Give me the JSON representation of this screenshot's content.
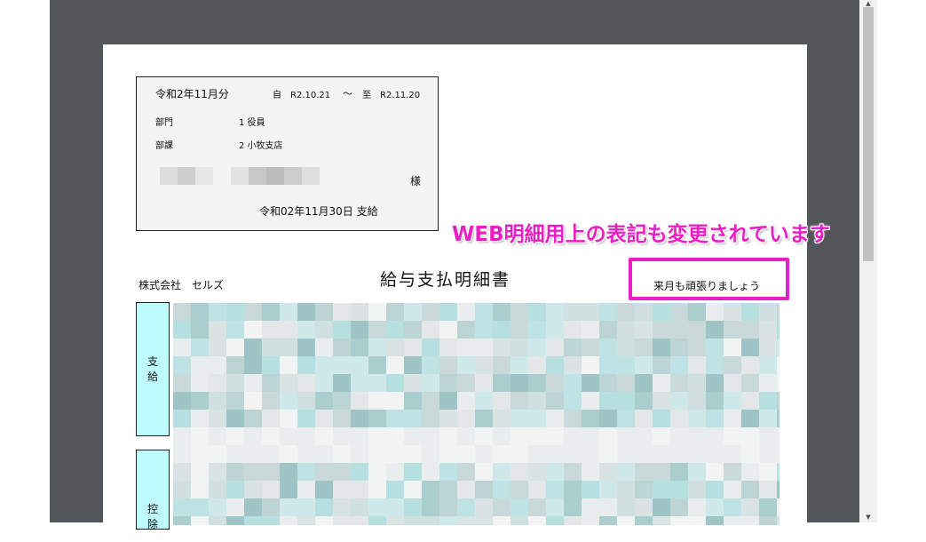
{
  "header": {
    "period_title": "令和2年11月分",
    "period_from": "自　R2.10.21",
    "period_tilde": "～",
    "period_to": "至　R2.11.20",
    "department_label": "部門",
    "department_value": "1 役員",
    "section_label": "部課",
    "section_value": "2 小牧支店",
    "honorific": "様",
    "pay_date": "令和02年11月30日 支給"
  },
  "company": "株式会社　セルズ",
  "document_title": "給与支払明細書",
  "message": "来月も頑張りましょう",
  "annotation": "WEB明細用上の表記も変更されています",
  "sections": {
    "payment_label": "支\n給",
    "deduction_label": "控\n除"
  },
  "colors": {
    "viewer_background": "#525659",
    "annotation_accent": "#e91fc4",
    "section_fill": "#bdfbff",
    "info_box_fill": "#f4f4f4"
  },
  "icons": {
    "scroll_up": "scroll-up-arrow-icon",
    "scroll_down": "scroll-down-arrow-icon"
  }
}
